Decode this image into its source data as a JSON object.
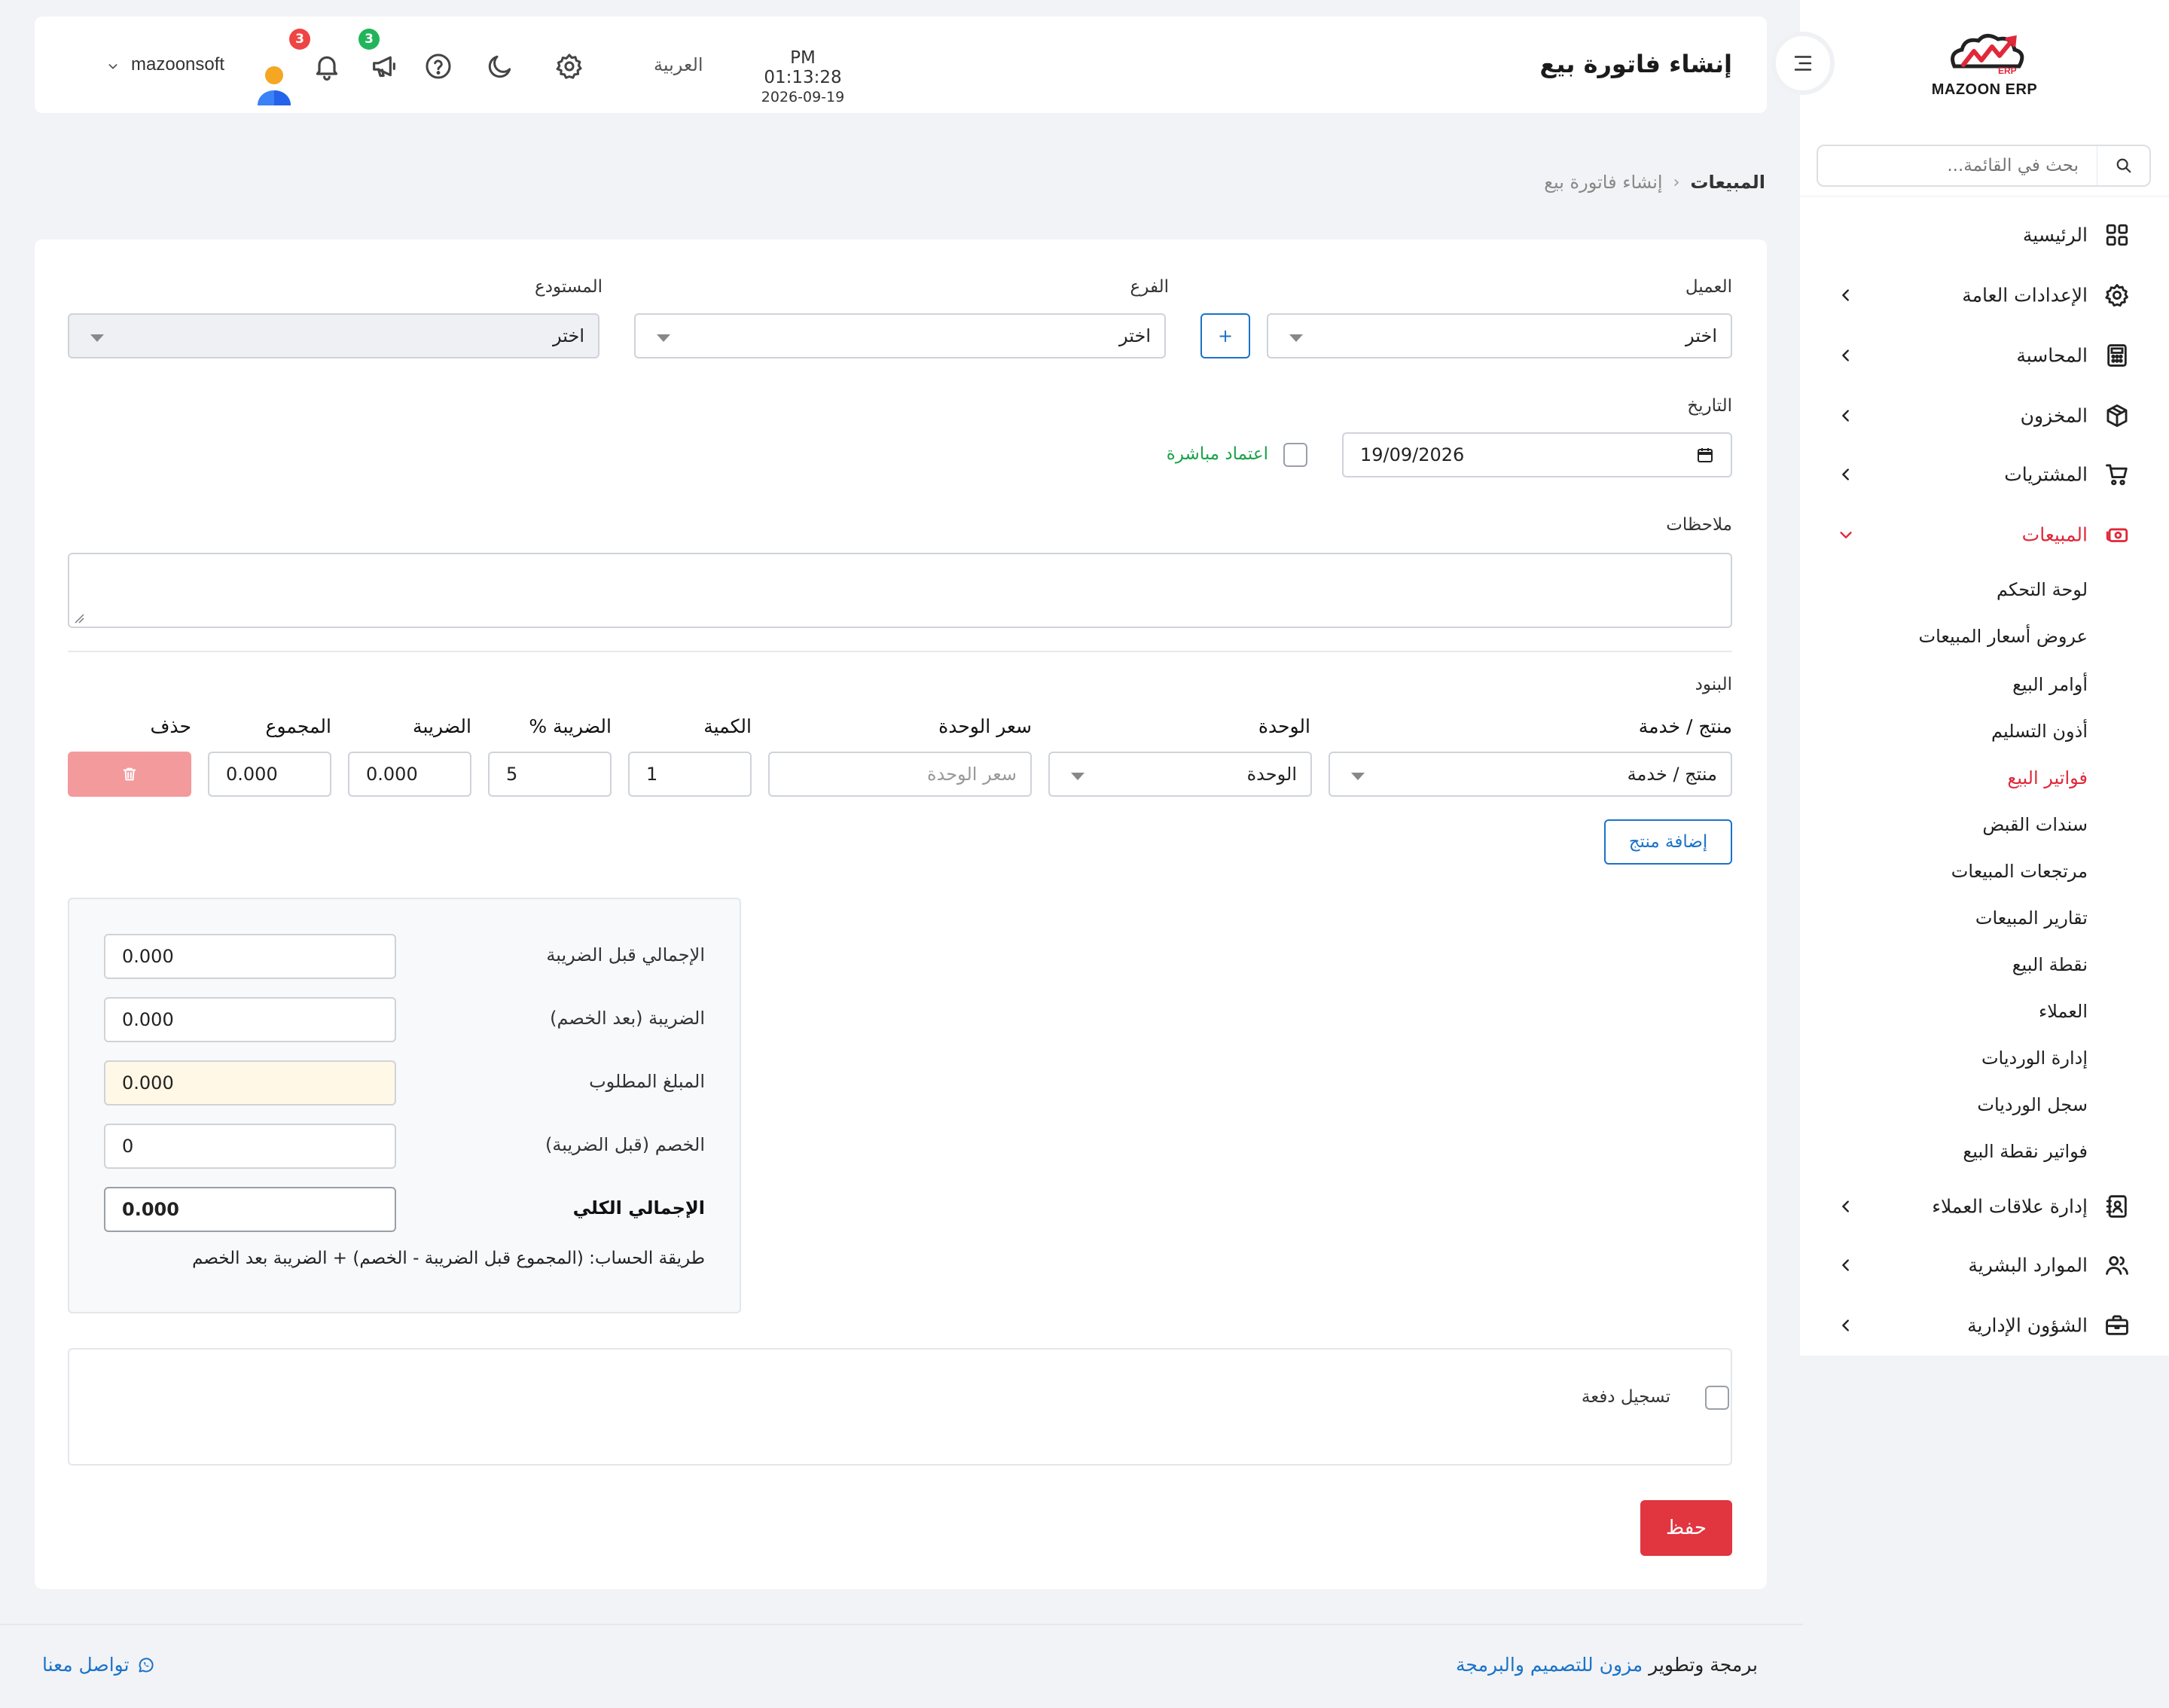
{
  "header": {
    "title": "إنشاء فاتورة بيع",
    "time": "PM 01:13:28",
    "date": "2026-09-19",
    "language": "العربية",
    "notifications_count": "3",
    "announcements_count": "3",
    "username": "mazoonsoft"
  },
  "sidebar": {
    "logo_text": "MAZOON ERP",
    "logo_tag": "ERP",
    "search_placeholder": "بحث في القائمة...",
    "items": [
      {
        "label": "الرئيسية",
        "icon": "grid-icon"
      },
      {
        "label": "الإعدادات العامة",
        "icon": "gear-icon"
      },
      {
        "label": "المحاسبة",
        "icon": "calculator-icon"
      },
      {
        "label": "المخزون",
        "icon": "box-icon"
      },
      {
        "label": "المشتريات",
        "icon": "cart-icon"
      },
      {
        "label": "المبيعات",
        "icon": "cash-icon"
      },
      {
        "label": "إدارة علاقات العملاء",
        "icon": "contacts-icon"
      },
      {
        "label": "الموارد البشرية",
        "icon": "users-icon"
      },
      {
        "label": "الشؤون الإدارية",
        "icon": "briefcase-icon"
      }
    ],
    "sales_sub": [
      "لوحة التحكم",
      "عروض أسعار المبيعات",
      "أوامر البيع",
      "أذون التسليم",
      "فواتير البيع",
      "سندات القبض",
      "مرتجعات المبيعات",
      "تقارير المبيعات",
      "نقطة البيع",
      "العملاء",
      "إدارة الورديات",
      "سجل الورديات",
      "فواتير نقطة البيع"
    ]
  },
  "breadcrumb": {
    "root": "المبيعات",
    "current": "إنشاء فاتورة بيع"
  },
  "form": {
    "customer_label": "العميل",
    "customer_value": "اختر",
    "add_button": "+",
    "branch_label": "الفرع",
    "branch_value": "اختر",
    "warehouse_label": "المستودع",
    "warehouse_value": "اختر",
    "date_label": "التاريخ",
    "date_value": "19/09/2026",
    "direct_approval_label": "اعتماد مباشرة",
    "notes_label": "ملاحظات",
    "items_label": "البنود",
    "columns": {
      "product": "منتج / خدمة",
      "unit": "الوحدة",
      "unit_price": "سعر الوحدة",
      "quantity": "الكمية",
      "tax_percent": "الضريبة %",
      "tax": "الضريبة",
      "total": "المجموع",
      "delete": "حذف"
    },
    "row": {
      "product_placeholder": "منتج / خدمة",
      "unit_placeholder": "الوحدة",
      "unit_price_placeholder": "سعر الوحدة",
      "quantity": "1",
      "tax_percent": "5",
      "tax": "0.000",
      "total": "0.000"
    },
    "add_product_button": "إضافة منتج"
  },
  "totals": {
    "subtotal_label": "الإجمالي قبل الضريبة",
    "subtotal_value": "0.000",
    "tax_label": "الضريبة (بعد الخصم)",
    "tax_value": "0.000",
    "due_label": "المبلغ المطلوب",
    "due_value": "0.000",
    "discount_label": "الخصم (قبل الضريبة)",
    "discount_value": "0",
    "grand_total_label": "الإجمالي الكلي",
    "grand_total_value": "0.000",
    "method_note": "طريقة الحساب: (المجموع قبل الضريبة - الخصم) + الضريبة بعد الخصم"
  },
  "payment": {
    "register_label": "تسجيل دفعة"
  },
  "save_button": "حفظ",
  "footer": {
    "credit_prefix": "برمجة وتطوير",
    "credit_link": "مزون للتصميم والبرمجة",
    "contact": "تواصل معنا"
  },
  "colors": {
    "accent_red": "#e0283a",
    "link_blue": "#1a73c8",
    "approval_green": "#1aa34a",
    "badge_red": "#ef4444",
    "badge_green": "#22b45a"
  }
}
